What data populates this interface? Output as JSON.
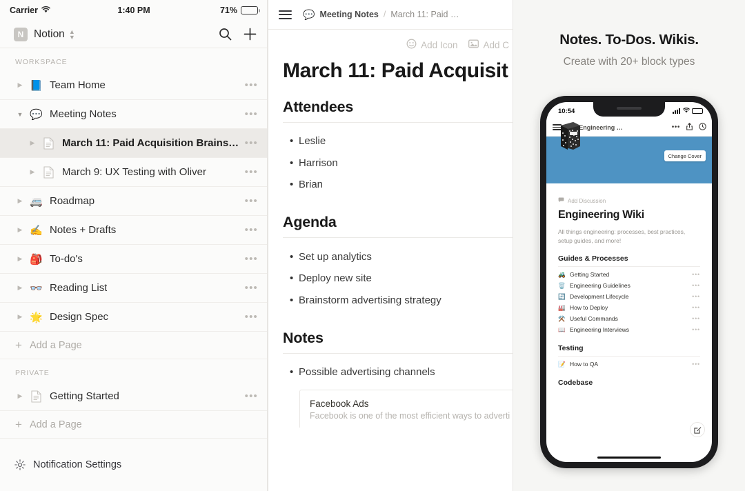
{
  "status_bar": {
    "carrier": "Carrier",
    "wifi_icon": "wifi-icon",
    "time": "1:40 PM",
    "battery_percent": "71%",
    "battery_level": 71
  },
  "sidebar": {
    "workspace": {
      "avatar_letter": "N",
      "name": "Notion",
      "switcher_icon": "chevron-updown-icon",
      "search_icon": "search-icon",
      "add_icon": "plus-icon"
    },
    "sections": [
      {
        "label": "WORKSPACE",
        "items": [
          {
            "emoji": "📘",
            "label": "Team Home",
            "indent": false,
            "expanded": false,
            "selected": false,
            "icon_type": "emoji"
          },
          {
            "emoji": "💬",
            "label": "Meeting Notes",
            "indent": false,
            "expanded": true,
            "selected": false,
            "icon_type": "emoji"
          },
          {
            "emoji": "",
            "label": "March 11: Paid Acquisition Brainst…",
            "indent": true,
            "expanded": false,
            "selected": true,
            "icon_type": "doc"
          },
          {
            "emoji": "",
            "label": "March 9: UX Testing with Oliver",
            "indent": true,
            "expanded": false,
            "selected": false,
            "icon_type": "doc"
          },
          {
            "emoji": "🚐",
            "label": "Roadmap",
            "indent": false,
            "expanded": false,
            "selected": false,
            "icon_type": "emoji"
          },
          {
            "emoji": "✍️",
            "label": "Notes + Drafts",
            "indent": false,
            "expanded": false,
            "selected": false,
            "icon_type": "emoji"
          },
          {
            "emoji": "🎒",
            "label": "To-do's",
            "indent": false,
            "expanded": false,
            "selected": false,
            "icon_type": "emoji"
          },
          {
            "emoji": "👓",
            "label": "Reading List",
            "indent": false,
            "expanded": false,
            "selected": false,
            "icon_type": "emoji"
          },
          {
            "emoji": "🌟",
            "label": "Design Spec",
            "indent": false,
            "expanded": false,
            "selected": false,
            "icon_type": "emoji"
          }
        ],
        "add_label": "Add a Page"
      },
      {
        "label": "PRIVATE",
        "items": [
          {
            "emoji": "",
            "label": "Getting Started",
            "indent": false,
            "expanded": false,
            "selected": false,
            "icon_type": "doc"
          }
        ],
        "add_label": "Add a Page"
      }
    ],
    "settings": {
      "icon": "gear-icon",
      "label": "Notification Settings"
    },
    "row_menu_icon": "ellipsis-icon"
  },
  "document": {
    "menu_icon": "hamburger-icon",
    "breadcrumb": {
      "parent_emoji": "💬",
      "parent": "Meeting Notes",
      "separator": "/",
      "current": "March 11: Paid …"
    },
    "actions": [
      {
        "icon": "smiley-icon",
        "label": "Add Icon"
      },
      {
        "icon": "image-icon",
        "label": "Add C"
      }
    ],
    "title": "March 11: Paid Acquisit",
    "blocks": [
      {
        "type": "heading",
        "text": "Attendees"
      },
      {
        "type": "bullets",
        "items": [
          "Leslie",
          "Harrison",
          "Brian"
        ]
      },
      {
        "type": "heading",
        "text": "Agenda"
      },
      {
        "type": "bullets",
        "items": [
          "Set up analytics",
          "Deploy new site",
          "Brainstorm advertising strategy"
        ]
      },
      {
        "type": "heading",
        "text": "Notes"
      },
      {
        "type": "bullets",
        "items": [
          "Possible advertising channels"
        ]
      }
    ],
    "callout": {
      "title": "Facebook Ads",
      "description": "Facebook is one of the most efficient ways to adverti"
    }
  },
  "promo": {
    "title": "Notes. To-Dos. Wikis.",
    "subtitle": "Create with 20+ block types",
    "phone": {
      "status": {
        "time": "10:54",
        "signal_icon": "cellular-bars-icon",
        "wifi_icon": "wifi-icon",
        "battery_icon": "battery-icon"
      },
      "nav": {
        "menu_icon": "hamburger-icon",
        "crumb_emoji": "📓",
        "crumb": "Engineering …",
        "more_icon": "ellipsis-icon",
        "share_icon": "share-icon",
        "history_icon": "clock-icon"
      },
      "cover_color": "#4e93c3",
      "change_cover_label": "Change Cover",
      "page_icon": "📓",
      "add_discussion": {
        "icon": "comment-icon",
        "label": "Add Discussion"
      },
      "page_title": "Engineering Wiki",
      "page_description": "All things engineering: processes, best practices, setup guides, and more!",
      "sections": [
        {
          "heading": "Guides & Processes",
          "items": [
            {
              "emoji": "🚜",
              "label": "Getting Started"
            },
            {
              "emoji": "🗑️",
              "label": "Engineering Guidelines"
            },
            {
              "emoji": "🔄",
              "label": "Development Lifecycle"
            },
            {
              "emoji": "🏭",
              "label": "How to Deploy"
            },
            {
              "emoji": "⚒️",
              "label": "Useful Commands"
            },
            {
              "emoji": "📖",
              "label": "Engineering Interviews"
            }
          ]
        },
        {
          "heading": "Testing",
          "items": [
            {
              "emoji": "📝",
              "label": "How to QA"
            }
          ]
        },
        {
          "heading": "Codebase",
          "items": []
        }
      ],
      "fab_icon": "compose-icon",
      "item_menu_icon": "ellipsis-icon"
    }
  }
}
